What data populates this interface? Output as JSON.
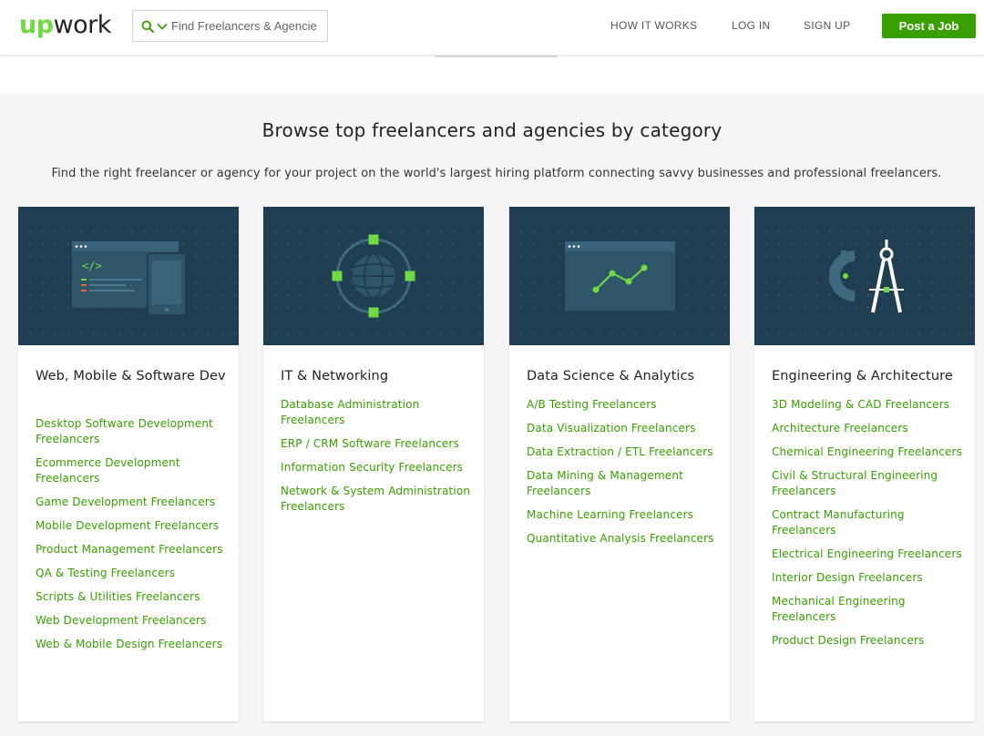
{
  "header": {
    "logo_up": "up",
    "logo_work": "work",
    "search_placeholder": "Find Freelancers & Agencies",
    "nav": [
      "HOW IT WORKS",
      "LOG IN",
      "SIGN UP"
    ],
    "post_job_label": "Post a Job",
    "accent_color": "#37a000",
    "logo_green": "#6fda44"
  },
  "section": {
    "title": "Browse top freelancers and agencies by category",
    "subtitle": "Find the right freelancer or agency for your project on the world's largest hiring platform connecting savvy businesses and professional freelancers."
  },
  "categories": [
    {
      "title": "Web, Mobile & Software Dev",
      "icon": "code-window-phone-icon",
      "links": [
        "Desktop Software Development Freelancers",
        "Ecommerce Development Freelancers",
        "Game Development Freelancers",
        "Mobile Development Freelancers",
        "Product Management Freelancers",
        "QA & Testing Freelancers",
        "Scripts & Utilities Freelancers",
        "Web Development Freelancers",
        "Web & Mobile Design Freelancers"
      ]
    },
    {
      "title": "IT & Networking",
      "icon": "globe-network-icon",
      "links": [
        "Database Administration Freelancers",
        "ERP / CRM Software Freelancers",
        "Information Security Freelancers",
        "Network & System Administration Freelancers"
      ]
    },
    {
      "title": "Data Science & Analytics",
      "icon": "line-chart-window-icon",
      "links": [
        "A/B Testing Freelancers",
        "Data Visualization Freelancers",
        "Data Extraction / ETL Freelancers",
        "Data Mining & Management Freelancers",
        "Machine Learning Freelancers",
        "Quantitative Analysis Freelancers"
      ]
    },
    {
      "title": "Engineering & Architecture",
      "icon": "compass-protractor-icon",
      "links": [
        "3D Modeling & CAD Freelancers",
        "Architecture Freelancers",
        "Chemical Engineering Freelancers",
        "Civil & Structural Engineering Freelancers",
        "Contract Manufacturing Freelancers",
        "Electrical Engineering Freelancers",
        "Interior Design Freelancers",
        "Mechanical Engineering Freelancers",
        "Product Design Freelancers"
      ]
    }
  ]
}
